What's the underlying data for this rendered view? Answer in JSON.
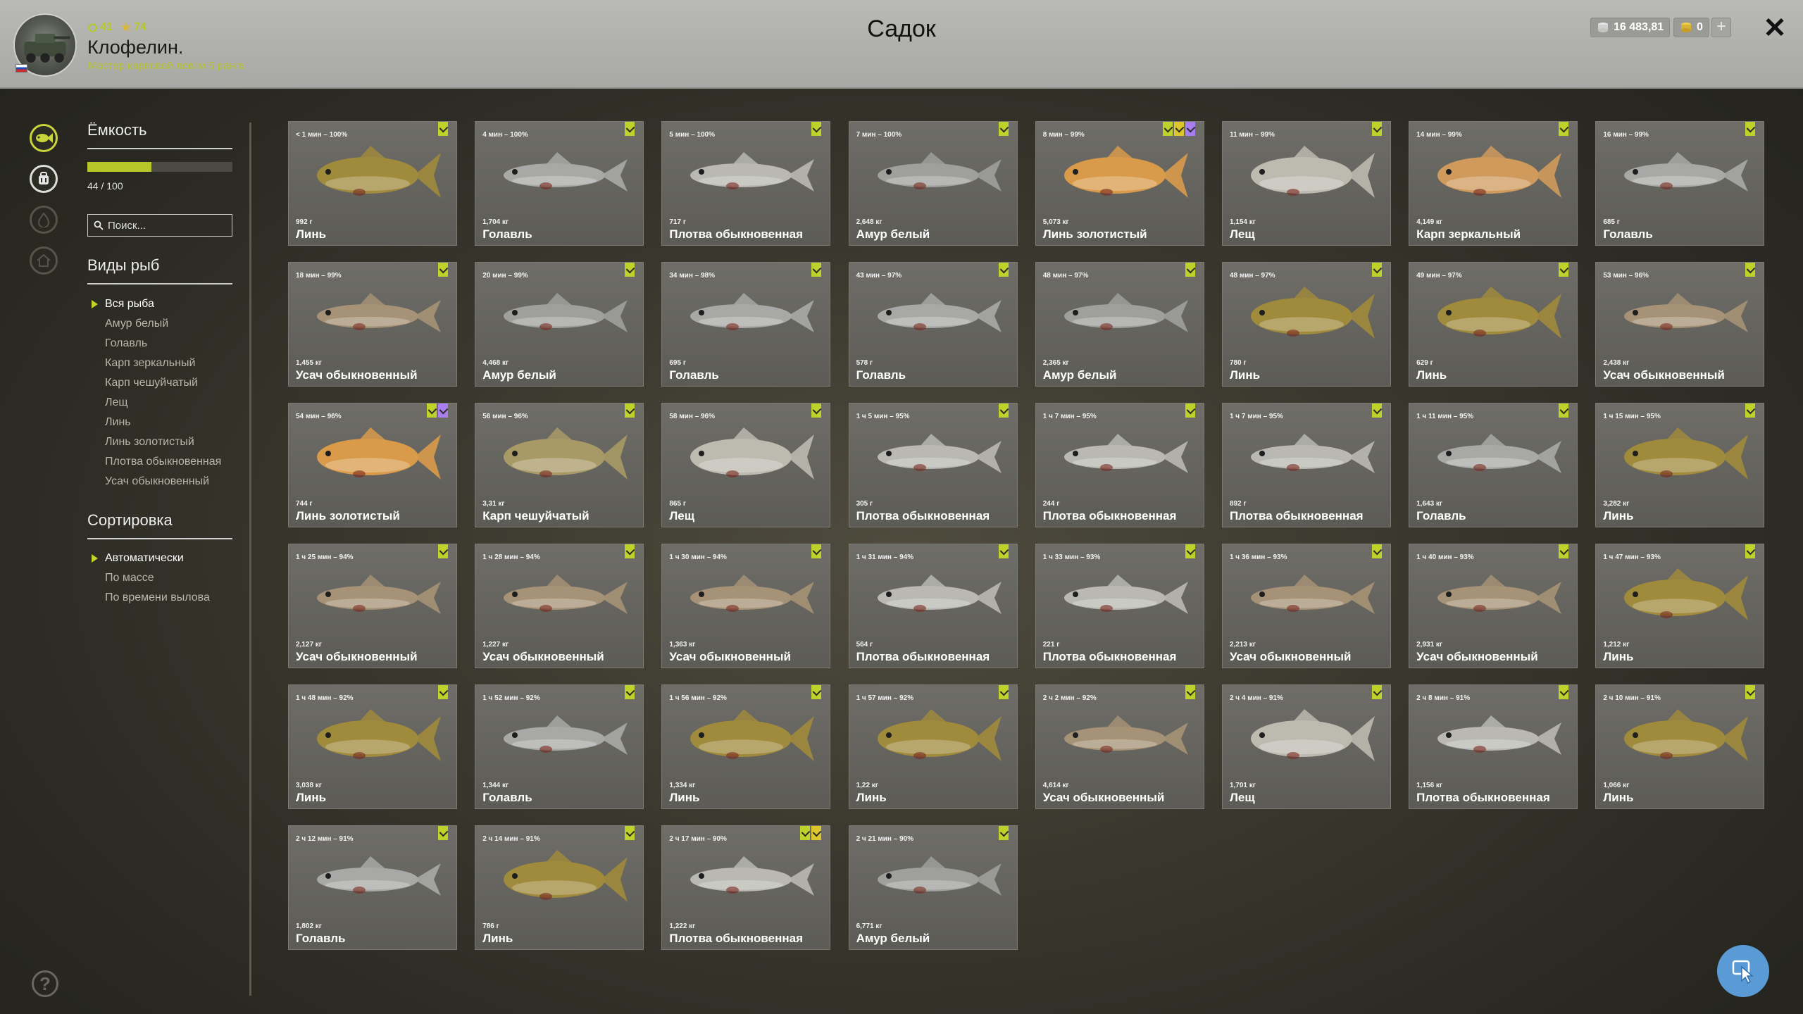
{
  "header": {
    "title": "Садок",
    "player": {
      "name": "Клофелин.",
      "rank": "Мастер карповой ловли 5 ранга",
      "level": "41",
      "stars": "74"
    },
    "silver": "16 483,81",
    "gold": "0",
    "plus_label": "+",
    "close_label": "✕"
  },
  "capacity": {
    "title": "Ёмкость",
    "text": "44 / 100",
    "fill_fraction": 0.44,
    "search_placeholder": "Поиск..."
  },
  "species": {
    "title": "Виды рыб",
    "items": [
      "Вся рыба",
      "Амур белый",
      "Голавль",
      "Карп зеркальный",
      "Карп чешуйчатый",
      "Лещ",
      "Линь",
      "Линь золотистый",
      "Плотва обыкновенная",
      "Усач обыкновенный"
    ],
    "selected": 0
  },
  "sorting": {
    "title": "Сортировка",
    "items": [
      "Автоматически",
      "По массе",
      "По времени вылова"
    ],
    "selected": 0
  },
  "help_label": "?",
  "colors": {
    "accent": "#c3d32b",
    "fish": {
      "Линь": "#a08a3c",
      "Голавль": "#a8a9a6",
      "Плотва обыкновенная": "#b9b8b2",
      "Амур белый": "#9fa09c",
      "Линь золотистый": "#d99b4a",
      "Лещ": "#bdbab0",
      "Карп зеркальный": "#cf9a5c",
      "Усач обыкновенный": "#a69276",
      "Карп чешуйчатый": "#a89a66"
    }
  },
  "fish": [
    {
      "time": "< 1 мин – 100%",
      "weight": "992 г",
      "name": "Линь",
      "marks": [
        "green"
      ]
    },
    {
      "time": "4 мин – 100%",
      "weight": "1,704 кг",
      "name": "Голавль",
      "marks": [
        "green"
      ]
    },
    {
      "time": "5 мин – 100%",
      "weight": "717 г",
      "name": "Плотва обыкновенная",
      "marks": [
        "green"
      ]
    },
    {
      "time": "7 мин – 100%",
      "weight": "2,648 кг",
      "name": "Амур белый",
      "marks": [
        "green"
      ]
    },
    {
      "time": "8 мин – 99%",
      "weight": "5,073 кг",
      "name": "Линь золотистый",
      "marks": [
        "green",
        "yellow",
        "purple"
      ]
    },
    {
      "time": "11 мин – 99%",
      "weight": "1,154 кг",
      "name": "Лещ",
      "marks": [
        "green"
      ]
    },
    {
      "time": "14 мин – 99%",
      "weight": "4,149 кг",
      "name": "Карп зеркальный",
      "marks": [
        "green"
      ]
    },
    {
      "time": "16 мин – 99%",
      "weight": "685 г",
      "name": "Голавль",
      "marks": [
        "green"
      ]
    },
    {
      "time": "18 мин – 99%",
      "weight": "1,455 кг",
      "name": "Усач обыкновенный",
      "marks": [
        "green"
      ]
    },
    {
      "time": "20 мин – 99%",
      "weight": "4,468 кг",
      "name": "Амур белый",
      "marks": [
        "green"
      ]
    },
    {
      "time": "34 мин – 98%",
      "weight": "695 г",
      "name": "Голавль",
      "marks": [
        "green"
      ]
    },
    {
      "time": "43 мин – 97%",
      "weight": "578 г",
      "name": "Голавль",
      "marks": [
        "green"
      ]
    },
    {
      "time": "48 мин – 97%",
      "weight": "2,365 кг",
      "name": "Амур белый",
      "marks": [
        "green"
      ]
    },
    {
      "time": "48 мин – 97%",
      "weight": "780 г",
      "name": "Линь",
      "marks": [
        "green"
      ]
    },
    {
      "time": "49 мин – 97%",
      "weight": "629 г",
      "name": "Линь",
      "marks": [
        "green"
      ]
    },
    {
      "time": "53 мин – 96%",
      "weight": "2,438 кг",
      "name": "Усач обыкновенный",
      "marks": [
        "green"
      ]
    },
    {
      "time": "54 мин – 96%",
      "weight": "744 г",
      "name": "Линь золотистый",
      "marks": [
        "green",
        "purple"
      ]
    },
    {
      "time": "56 мин – 96%",
      "weight": "3,31 кг",
      "name": "Карп чешуйчатый",
      "marks": [
        "green"
      ]
    },
    {
      "time": "58 мин – 96%",
      "weight": "865 г",
      "name": "Лещ",
      "marks": [
        "green"
      ]
    },
    {
      "time": "1 ч 5 мин – 95%",
      "weight": "305 г",
      "name": "Плотва обыкновенная",
      "marks": [
        "green"
      ]
    },
    {
      "time": "1 ч 7 мин – 95%",
      "weight": "244 г",
      "name": "Плотва обыкновенная",
      "marks": [
        "green"
      ]
    },
    {
      "time": "1 ч 7 мин – 95%",
      "weight": "892 г",
      "name": "Плотва обыкновенная",
      "marks": [
        "green"
      ]
    },
    {
      "time": "1 ч 11 мин – 95%",
      "weight": "1,643 кг",
      "name": "Голавль",
      "marks": [
        "green"
      ]
    },
    {
      "time": "1 ч 15 мин – 95%",
      "weight": "3,282 кг",
      "name": "Линь",
      "marks": [
        "green"
      ]
    },
    {
      "time": "1 ч 25 мин – 94%",
      "weight": "2,127 кг",
      "name": "Усач обыкновенный",
      "marks": [
        "green"
      ]
    },
    {
      "time": "1 ч 28 мин – 94%",
      "weight": "1,227 кг",
      "name": "Усач обыкновенный",
      "marks": [
        "green"
      ]
    },
    {
      "time": "1 ч 30 мин – 94%",
      "weight": "1,363 кг",
      "name": "Усач обыкновенный",
      "marks": [
        "green"
      ]
    },
    {
      "time": "1 ч 31 мин – 94%",
      "weight": "564 г",
      "name": "Плотва обыкновенная",
      "marks": [
        "green"
      ]
    },
    {
      "time": "1 ч 33 мин – 93%",
      "weight": "221 г",
      "name": "Плотва обыкновенная",
      "marks": [
        "green"
      ]
    },
    {
      "time": "1 ч 36 мин – 93%",
      "weight": "2,213 кг",
      "name": "Усач обыкновенный",
      "marks": [
        "green"
      ]
    },
    {
      "time": "1 ч 40 мин – 93%",
      "weight": "2,931 кг",
      "name": "Усач обыкновенный",
      "marks": [
        "green"
      ]
    },
    {
      "time": "1 ч 47 мин – 93%",
      "weight": "1,212 кг",
      "name": "Линь",
      "marks": [
        "green"
      ]
    },
    {
      "time": "1 ч 48 мин – 92%",
      "weight": "3,038 кг",
      "name": "Линь",
      "marks": [
        "green"
      ]
    },
    {
      "time": "1 ч 52 мин – 92%",
      "weight": "1,344 кг",
      "name": "Голавль",
      "marks": [
        "green"
      ]
    },
    {
      "time": "1 ч 56 мин – 92%",
      "weight": "1,334 кг",
      "name": "Линь",
      "marks": [
        "green"
      ]
    },
    {
      "time": "1 ч 57 мин – 92%",
      "weight": "1,22 кг",
      "name": "Линь",
      "marks": [
        "green"
      ]
    },
    {
      "time": "2 ч 2 мин – 92%",
      "weight": "4,614 кг",
      "name": "Усач обыкновенный",
      "marks": [
        "green"
      ]
    },
    {
      "time": "2 ч 4 мин – 91%",
      "weight": "1,701 кг",
      "name": "Лещ",
      "marks": [
        "green"
      ]
    },
    {
      "time": "2 ч 8 мин – 91%",
      "weight": "1,156 кг",
      "name": "Плотва обыкновенная",
      "marks": [
        "green"
      ]
    },
    {
      "time": "2 ч 10 мин – 91%",
      "weight": "1,066 кг",
      "name": "Линь",
      "marks": [
        "green"
      ]
    },
    {
      "time": "2 ч 12 мин – 91%",
      "weight": "1,802 кг",
      "name": "Голавль",
      "marks": [
        "green"
      ]
    },
    {
      "time": "2 ч 14 мин – 91%",
      "weight": "786 г",
      "name": "Линь",
      "marks": [
        "green"
      ]
    },
    {
      "time": "2 ч 17 мин – 90%",
      "weight": "1,222 кг",
      "name": "Плотва обыкновенная",
      "marks": [
        "green",
        "yellow"
      ]
    },
    {
      "time": "2 ч 21 мин – 90%",
      "weight": "6,771 кг",
      "name": "Амур белый",
      "marks": [
        "green"
      ]
    }
  ]
}
